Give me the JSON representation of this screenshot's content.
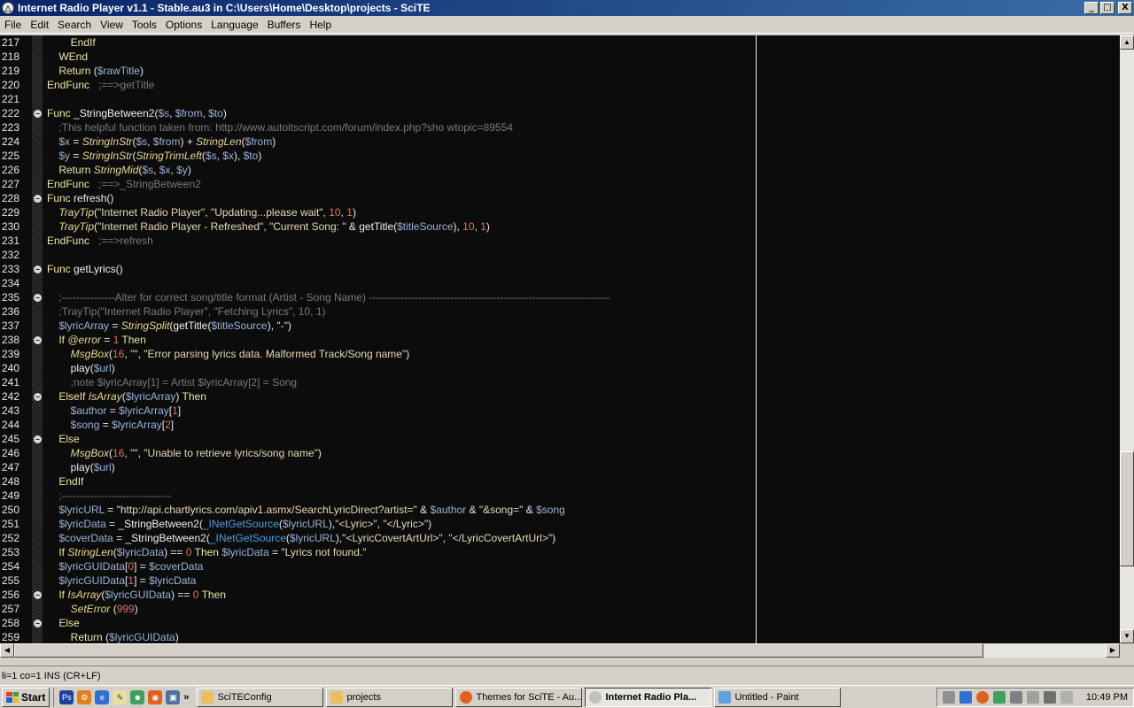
{
  "window": {
    "title": "Internet Radio Player v1.1 - Stable.au3 in C:\\Users\\Home\\Desktop\\projects - SciTE",
    "minimize": "_",
    "maximize": "□",
    "close": "X"
  },
  "menu": [
    "File",
    "Edit",
    "Search",
    "View",
    "Tools",
    "Options",
    "Language",
    "Buffers",
    "Help"
  ],
  "code": {
    "lines": [
      {
        "n": "217",
        "fold": false,
        "html": "        <span class='kw'>EndIf</span>"
      },
      {
        "n": "218",
        "fold": false,
        "html": "    <span class='kw'>WEnd</span>"
      },
      {
        "n": "219",
        "fold": false,
        "html": "    <span class='kw'>Return</span> <span class='op'>(</span><span class='var'>$rawTitle</span><span class='op'>)</span>"
      },
      {
        "n": "220",
        "fold": false,
        "html": "<span class='kw'>EndFunc</span>   <span class='cm'>;==&gt;getTitle</span>"
      },
      {
        "n": "221",
        "fold": false,
        "html": ""
      },
      {
        "n": "222",
        "fold": true,
        "html": "<span class='kw'>Func</span> <span class='udf'>_StringBetween2</span><span class='op'>(</span><span class='var'>$s</span><span class='op'>, </span><span class='var'>$from</span><span class='op'>, </span><span class='var'>$to</span><span class='op'>)</span>"
      },
      {
        "n": "223",
        "fold": false,
        "html": "    <span class='cm'>;This helpful function taken from: http://www.autoitscript.com/forum/index.php?sho wtopic=89554</span>"
      },
      {
        "n": "224",
        "fold": false,
        "html": "    <span class='var'>$x</span> <span class='op'>=</span> <span class='fn'>StringInStr</span><span class='op'>(</span><span class='var'>$s</span><span class='op'>, </span><span class='var'>$from</span><span class='op'>) + </span><span class='fn'>StringLen</span><span class='op'>(</span><span class='var'>$from</span><span class='op'>)</span>"
      },
      {
        "n": "225",
        "fold": false,
        "html": "    <span class='var'>$y</span> <span class='op'>=</span> <span class='fn'>StringInStr</span><span class='op'>(</span><span class='fn'>StringTrimLeft</span><span class='op'>(</span><span class='var'>$s</span><span class='op'>, </span><span class='var'>$x</span><span class='op'>), </span><span class='var'>$to</span><span class='op'>)</span>"
      },
      {
        "n": "226",
        "fold": false,
        "html": "    <span class='kw'>Return</span> <span class='fn'>StringMid</span><span class='op'>(</span><span class='var'>$s</span><span class='op'>, </span><span class='var'>$x</span><span class='op'>, </span><span class='var'>$y</span><span class='op'>)</span>"
      },
      {
        "n": "227",
        "fold": false,
        "html": "<span class='kw'>EndFunc</span>   <span class='cm'>;==&gt;_StringBetween2</span>"
      },
      {
        "n": "228",
        "fold": true,
        "html": "<span class='kw'>Func</span> <span class='udf'>refresh</span><span class='op'>()</span>"
      },
      {
        "n": "229",
        "fold": false,
        "html": "    <span class='fn'>TrayTip</span><span class='op'>(</span><span class='str'>\"Internet Radio Player\"</span><span class='op'>, </span><span class='str'>\"Updating...please wait\"</span><span class='op'>, </span><span class='num'>10</span><span class='op'>, </span><span class='num'>1</span><span class='op'>)</span>"
      },
      {
        "n": "230",
        "fold": false,
        "html": "    <span class='fn'>TrayTip</span><span class='op'>(</span><span class='str'>\"Internet Radio Player - Refreshed\"</span><span class='op'>, </span><span class='str'>\"Current Song: \"</span><span class='op'> &amp; </span><span class='udf'>getTitle</span><span class='op'>(</span><span class='var'>$titleSource</span><span class='op'>), </span><span class='num'>10</span><span class='op'>, </span><span class='num'>1</span><span class='op'>)</span>"
      },
      {
        "n": "231",
        "fold": false,
        "html": "<span class='kw'>EndFunc</span>   <span class='cm'>;==&gt;refresh</span>"
      },
      {
        "n": "232",
        "fold": false,
        "html": ""
      },
      {
        "n": "233",
        "fold": true,
        "html": "<span class='kw'>Func</span> <span class='udf'>getLyrics</span><span class='op'>()</span>"
      },
      {
        "n": "234",
        "fold": false,
        "html": ""
      },
      {
        "n": "235",
        "fold": true,
        "html": "    <span class='cm'>;---------------Alter for correct song/title format (Artist - Song Name) --------------------------------------------------------------------</span>"
      },
      {
        "n": "236",
        "fold": false,
        "html": "    <span class='cm'>;TrayTip(\"Internet Radio Player\", \"Fetching Lyrics\", 10, 1)</span>"
      },
      {
        "n": "237",
        "fold": false,
        "html": "    <span class='var'>$lyricArray</span> <span class='op'>=</span> <span class='fn'>StringSplit</span><span class='op'>(</span><span class='udf'>getTitle</span><span class='op'>(</span><span class='var'>$titleSource</span><span class='op'>), </span><span class='str'>\"-\"</span><span class='op'>)</span>"
      },
      {
        "n": "238",
        "fold": true,
        "html": "    <span class='kw'>If</span> <span class='mac'>@error</span> <span class='op'>=</span> <span class='num'>1</span> <span class='kw'>Then</span>"
      },
      {
        "n": "239",
        "fold": false,
        "html": "        <span class='fn'>MsgBox</span><span class='op'>(</span><span class='num'>16</span><span class='op'>, </span><span class='str'>\"\"</span><span class='op'>, </span><span class='str'>\"Error parsing lyrics data. Malformed Track/Song name\"</span><span class='op'>)</span>"
      },
      {
        "n": "240",
        "fold": false,
        "html": "        <span class='udf'>play</span><span class='op'>(</span><span class='var'>$url</span><span class='op'>)</span>"
      },
      {
        "n": "241",
        "fold": false,
        "html": "        <span class='cm'>;note $lyricArray[1] = Artist $lyricArray[2] = Song</span>"
      },
      {
        "n": "242",
        "fold": true,
        "html": "    <span class='kw'>ElseIf</span> <span class='fn'>IsArray</span><span class='op'>(</span><span class='var'>$lyricArray</span><span class='op'>)</span> <span class='kw'>Then</span>"
      },
      {
        "n": "243",
        "fold": false,
        "html": "        <span class='var'>$author</span> <span class='op'>=</span> <span class='var'>$lyricArray</span><span class='op'>[</span><span class='num'>1</span><span class='op'>]</span>"
      },
      {
        "n": "244",
        "fold": false,
        "html": "        <span class='var'>$song</span> <span class='op'>=</span> <span class='var'>$lyricArray</span><span class='op'>[</span><span class='num'>2</span><span class='op'>]</span>"
      },
      {
        "n": "245",
        "fold": true,
        "html": "    <span class='kw'>Else</span>"
      },
      {
        "n": "246",
        "fold": false,
        "html": "        <span class='fn'>MsgBox</span><span class='op'>(</span><span class='num'>16</span><span class='op'>, </span><span class='str'>\"\"</span><span class='op'>, </span><span class='str'>\"Unable to retrieve lyrics/song name\"</span><span class='op'>)</span>"
      },
      {
        "n": "247",
        "fold": false,
        "html": "        <span class='udf'>play</span><span class='op'>(</span><span class='var'>$url</span><span class='op'>)</span>"
      },
      {
        "n": "248",
        "fold": false,
        "html": "    <span class='kw'>EndIf</span>"
      },
      {
        "n": "249",
        "fold": false,
        "html": "    <span class='cm'>;-------------------------------</span>"
      },
      {
        "n": "250",
        "fold": false,
        "html": "    <span class='var'>$lyricURL</span> <span class='op'>=</span> <span class='str'>\"http://api.chartlyrics.com/apiv1.asmx/SearchLyricDirect?artist=\"</span><span class='op'> &amp; </span><span class='var'>$author</span><span class='op'> &amp; </span><span class='str'>\"&amp;song=\"</span><span class='op'> &amp; </span><span class='var'>$song</span>"
      },
      {
        "n": "251",
        "fold": false,
        "html": "    <span class='var'>$lyricData</span> <span class='op'>=</span> <span class='udf'>_StringBetween2</span><span class='op'>(</span><span class='inet'>_INetGetSource</span><span class='op'>(</span><span class='var'>$lyricURL</span><span class='op'>),</span><span class='str'>\"&lt;Lyric&gt;\"</span><span class='op'>, </span><span class='str'>\"&lt;/Lyric&gt;\"</span><span class='op'>)</span>"
      },
      {
        "n": "252",
        "fold": false,
        "html": "    <span class='var'>$coverData</span> <span class='op'>=</span> <span class='udf'>_StringBetween2</span><span class='op'>(</span><span class='inet'>_INetGetSource</span><span class='op'>(</span><span class='var'>$lyricURL</span><span class='op'>),</span><span class='str'>\"&lt;LyricCovertArtUrl&gt;\"</span><span class='op'>, </span><span class='str'>\"&lt;/LyricCovertArtUrl&gt;\"</span><span class='op'>)</span>"
      },
      {
        "n": "253",
        "fold": false,
        "html": "    <span class='kw'>If</span> <span class='fn'>StringLen</span><span class='op'>(</span><span class='var'>$lyricData</span><span class='op'>) ==</span> <span class='num'>0</span> <span class='kw'>Then</span> <span class='var'>$lyricData</span> <span class='op'>=</span> <span class='str'>\"Lyrics not found.\"</span>"
      },
      {
        "n": "254",
        "fold": false,
        "html": "    <span class='var'>$lyricGUIData</span><span class='op'>[</span><span class='num'>0</span><span class='op'>] =</span> <span class='var'>$coverData</span>"
      },
      {
        "n": "255",
        "fold": false,
        "html": "    <span class='var'>$lyricGUIData</span><span class='op'>[</span><span class='num'>1</span><span class='op'>] =</span> <span class='var'>$lyricData</span>"
      },
      {
        "n": "256",
        "fold": true,
        "html": "    <span class='kw'>If</span> <span class='fn'>IsArray</span><span class='op'>(</span><span class='var'>$lyricGUIData</span><span class='op'>) ==</span> <span class='num'>0</span> <span class='kw'>Then</span>"
      },
      {
        "n": "257",
        "fold": false,
        "html": "        <span class='fn'>SetError</span> <span class='op'>(</span><span class='num'>999</span><span class='op'>)</span>"
      },
      {
        "n": "258",
        "fold": true,
        "html": "    <span class='kw'>Else</span>"
      },
      {
        "n": "259",
        "fold": false,
        "html": "        <span class='kw'>Return</span> <span class='op'>(</span><span class='var'>$lyricGUIData</span><span class='op'>)</span>"
      }
    ]
  },
  "status": "li=1 co=1 INS (CR+LF)",
  "taskbar": {
    "start": "Start",
    "tasks": [
      {
        "label": "SciTEConfig",
        "active": false,
        "color": "#e8c060"
      },
      {
        "label": "projects",
        "active": false,
        "color": "#e8c060"
      },
      {
        "label": "Themes for SciTE - Au...",
        "active": false,
        "color": "#e06020"
      },
      {
        "label": "Internet Radio Pla...",
        "active": true,
        "color": "#c0c0c0"
      },
      {
        "label": "Untitled - Paint",
        "active": false,
        "color": "#60a0e0"
      }
    ],
    "clock": "10:49 PM"
  }
}
